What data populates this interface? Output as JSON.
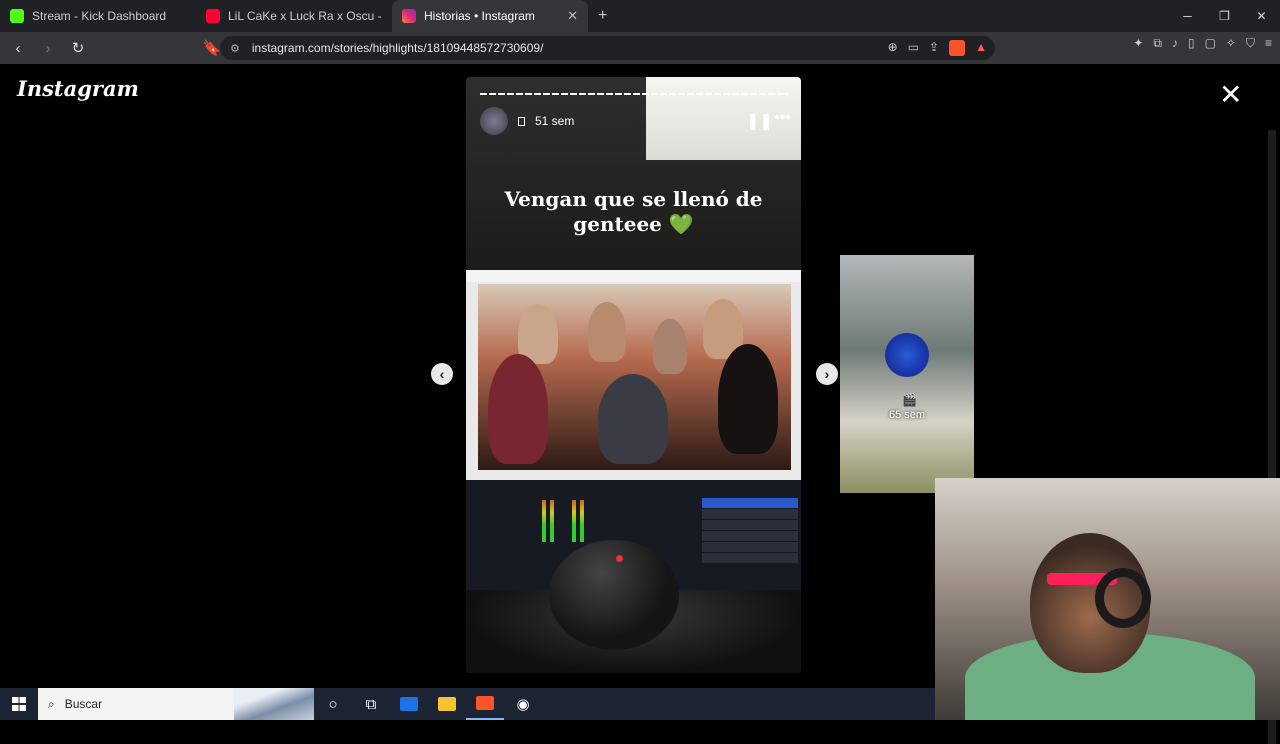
{
  "browser": {
    "tabs": [
      {
        "title": "Stream - Kick Dashboard",
        "color": "#53fc18"
      },
      {
        "title": "LiL CaKe x Luck Ra x Oscu - STAR",
        "color": "#ff0033"
      },
      {
        "title": "Historias • Instagram",
        "color": "#e1306c"
      }
    ],
    "new_tab": "+",
    "url": "instagram.com/stories/highlights/18109448572730609/",
    "brave_badge": "1"
  },
  "instagram": {
    "logo": "Instagram",
    "close": "✕",
    "story": {
      "time": "51 sem",
      "caption": "Vengan que se llenó de genteee 💚"
    },
    "next_story": {
      "time": "65 sem"
    }
  },
  "taskbar": {
    "search_placeholder": "Buscar"
  },
  "colors": {
    "accent": "#8ab4f8",
    "brave": "#fb542b"
  }
}
